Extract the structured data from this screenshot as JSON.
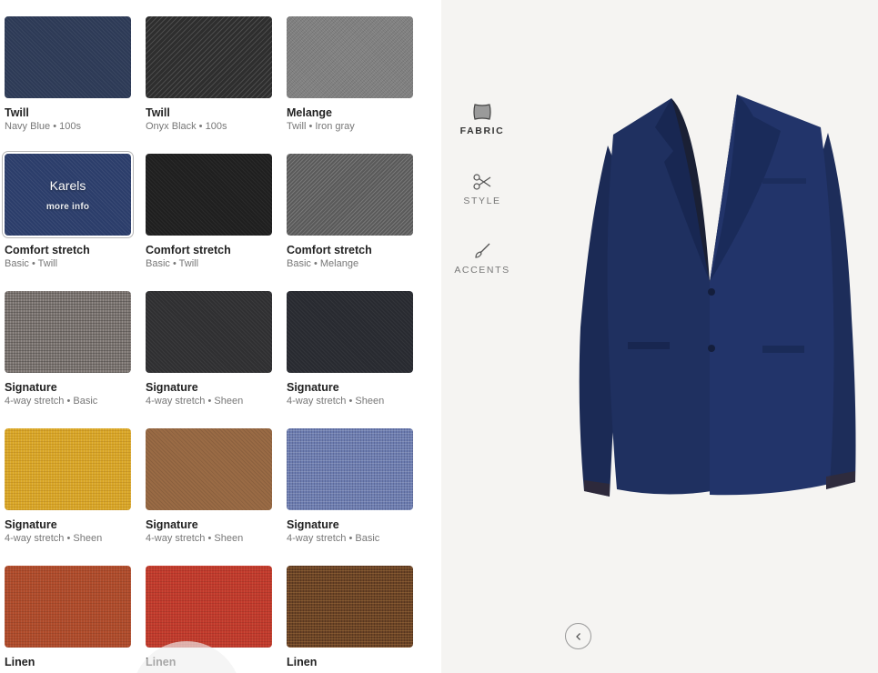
{
  "nav": {
    "fabric": {
      "label": "FABRIC",
      "icon": "fabric-swatch-icon"
    },
    "style": {
      "label": "STYLE",
      "icon": "scissors-icon"
    },
    "accents": {
      "label": "ACCENTS",
      "icon": "brush-icon"
    }
  },
  "selected_overlay": {
    "name": "Karels",
    "info": "more info"
  },
  "fabrics": [
    {
      "name": "Twill",
      "desc": "Navy Blue • 100s",
      "color": "#2d3a56"
    },
    {
      "name": "Twill",
      "desc": "Onyx Black • 100s",
      "color": "#2e2e2e"
    },
    {
      "name": "Melange",
      "desc": "Twill • Iron gray",
      "color": "#7e7e7e"
    },
    {
      "name": "Comfort stretch",
      "desc": "Basic • Twill",
      "color": "#2b3d6a"
    },
    {
      "name": "Comfort stretch",
      "desc": "Basic • Twill",
      "color": "#1f1f1f"
    },
    {
      "name": "Comfort stretch",
      "desc": "Basic • Melange",
      "color": "#5a5a5a"
    },
    {
      "name": "Signature",
      "desc": "4-way stretch • Basic",
      "color": "#7b7470"
    },
    {
      "name": "Signature",
      "desc": "4-way stretch • Sheen",
      "color": "#2f2f31"
    },
    {
      "name": "Signature",
      "desc": "4-way stretch • Sheen",
      "color": "#282a30"
    },
    {
      "name": "Signature",
      "desc": "4-way stretch • Sheen",
      "color": "#d9a626"
    },
    {
      "name": "Signature",
      "desc": "4-way stretch • Sheen",
      "color": "#9a6b45"
    },
    {
      "name": "Signature",
      "desc": "4-way stretch • Basic",
      "color": "#6d7db0"
    },
    {
      "name": "Linen",
      "desc": "",
      "color": "#b04b2a"
    },
    {
      "name": "Linen",
      "desc": "",
      "color": "#c23a2c"
    },
    {
      "name": "Linen",
      "desc": "",
      "color": "#6b4326"
    }
  ],
  "colors": {
    "jacket": "#1f3060",
    "panel_bg": "#f5f4f2"
  }
}
